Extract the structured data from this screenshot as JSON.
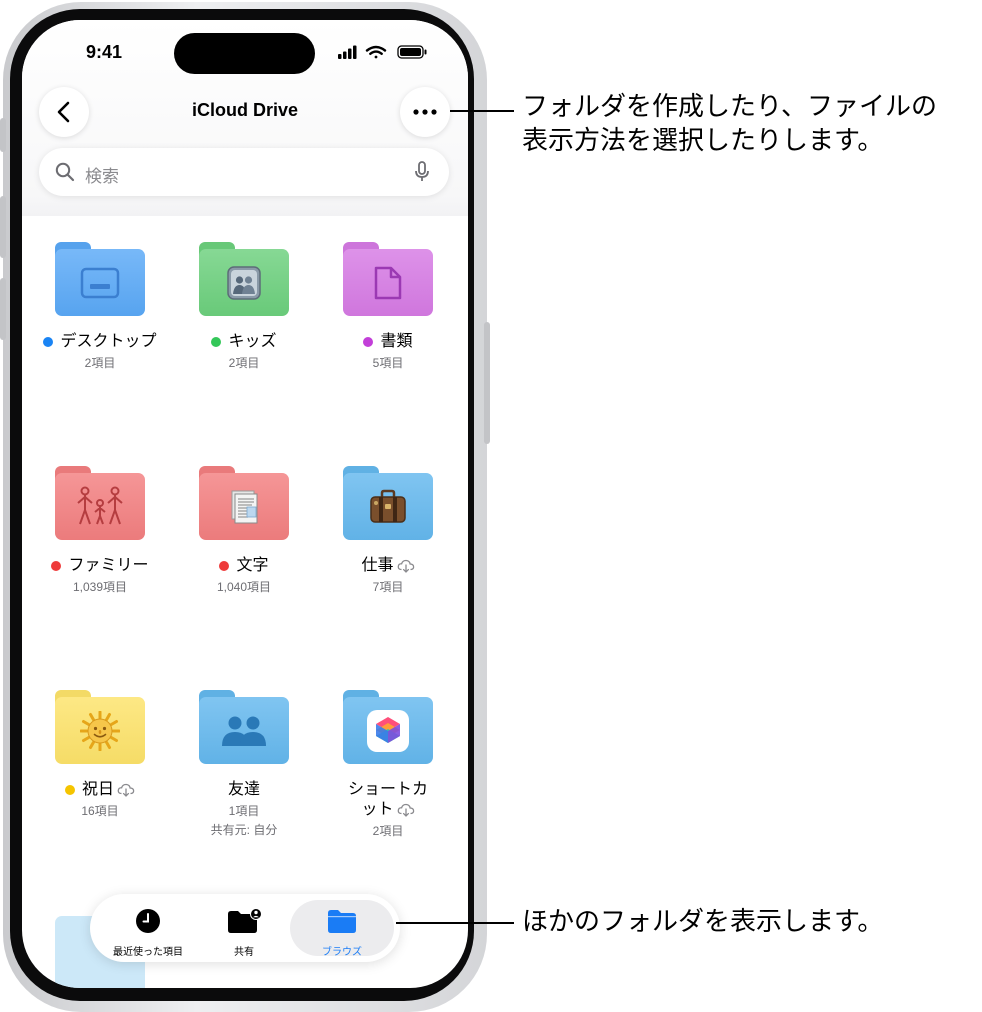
{
  "status_bar": {
    "time": "9:41"
  },
  "nav": {
    "title": "iCloud Drive"
  },
  "search": {
    "placeholder": "検索"
  },
  "folders": [
    {
      "name": "デスクトップ",
      "count": "2項目",
      "tag_color": "#1a84f4",
      "folder_color": "#5aa9f7",
      "icon": "desktop-icon"
    },
    {
      "name": "キッズ",
      "count": "2項目",
      "tag_color": "#34c759",
      "folder_color": "#6cd07d",
      "icon": "contacts-icon"
    },
    {
      "name": "書類",
      "count": "5項目",
      "tag_color": "#c23fd8",
      "folder_color": "#d67ae4",
      "icon": "document-icon"
    },
    {
      "name": "ファミリー",
      "count": "1,039項目",
      "tag_color": "#ee3b3b",
      "folder_color": "#f37f80",
      "icon": "family-icon"
    },
    {
      "name": "文字",
      "count": "1,040項目",
      "tag_color": "#ee3b3b",
      "folder_color": "#f37f80",
      "icon": "documents-stack-icon"
    },
    {
      "name": "仕事",
      "count": "7項目",
      "tag_color": "",
      "folder_color": "#64b8ee",
      "icon": "briefcase-icon",
      "cloud": true
    },
    {
      "name": "祝日",
      "count": "16項目",
      "tag_color": "#f5c400",
      "folder_color": "#fde36a",
      "icon": "sun-face-icon",
      "cloud": true
    },
    {
      "name": "友達",
      "count": "1項目",
      "shared": "共有元: 自分",
      "tag_color": "",
      "folder_color": "#64b8ee",
      "icon": "people-icon"
    },
    {
      "name": "ショートカ",
      "name2": "ット",
      "count": "2項目",
      "tag_color": "",
      "folder_color": "#64b8ee",
      "icon": "shortcuts-icon",
      "cloud": true
    }
  ],
  "tabbar": {
    "recents": "最近使った項目",
    "shared": "共有",
    "browse": "ブラウズ"
  },
  "callouts": {
    "top_line1": "フォルダを作成したり、ファイルの",
    "top_line2": "表示方法を選択したりします。",
    "bottom": "ほかのフォルダを表示します。"
  },
  "colors": {
    "accent": "#1a7cf5"
  }
}
